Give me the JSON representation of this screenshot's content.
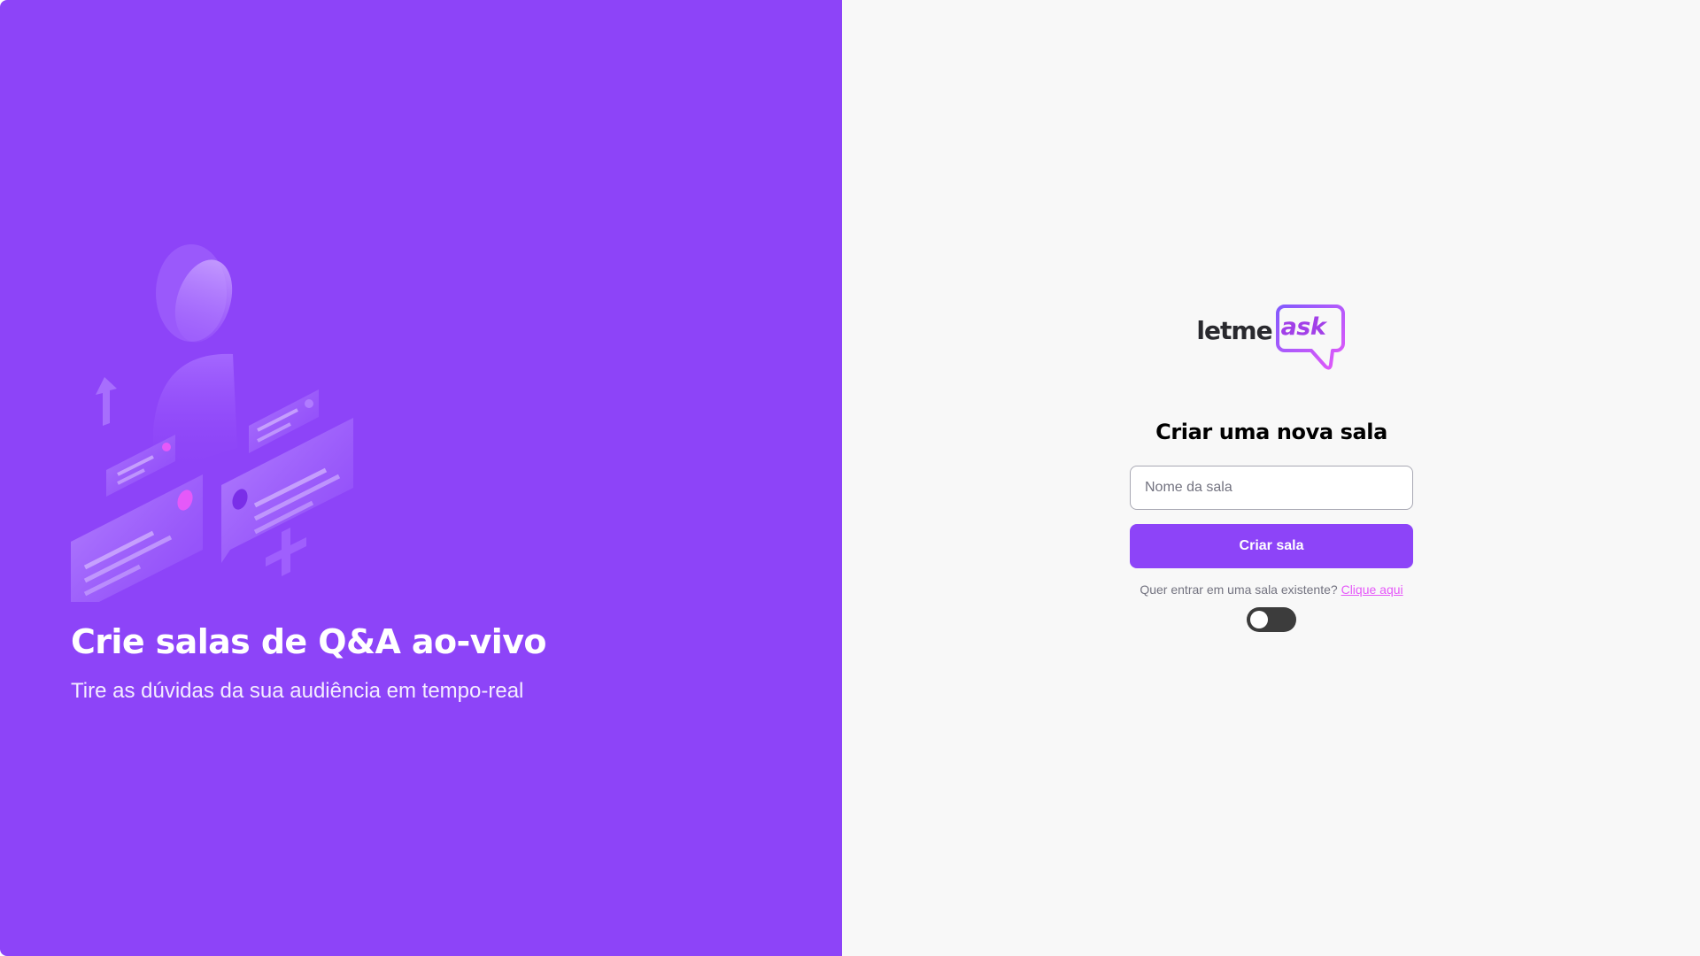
{
  "aside": {
    "illustration_icon": "illustration-qa-icon",
    "title": "Crie salas de Q&A ao-vivo",
    "subtitle": "Tire as dúvidas da sua audiência em tempo-real"
  },
  "logo": {
    "part1": "letme",
    "part2": "ask"
  },
  "form": {
    "heading": "Criar uma nova sala",
    "room_name_placeholder": "Nome da sala",
    "room_name_value": "",
    "submit_label": "Criar sala",
    "hint_text": "Quer entrar em uma sala existente?",
    "hint_link": "Clique aqui"
  },
  "theme_toggle": {
    "icon": "toggle-switch-icon",
    "state": "off"
  },
  "colors": {
    "brand_purple": "#8d44f8",
    "accent_pink": "#e559f9",
    "background": "#f8f8f8"
  }
}
